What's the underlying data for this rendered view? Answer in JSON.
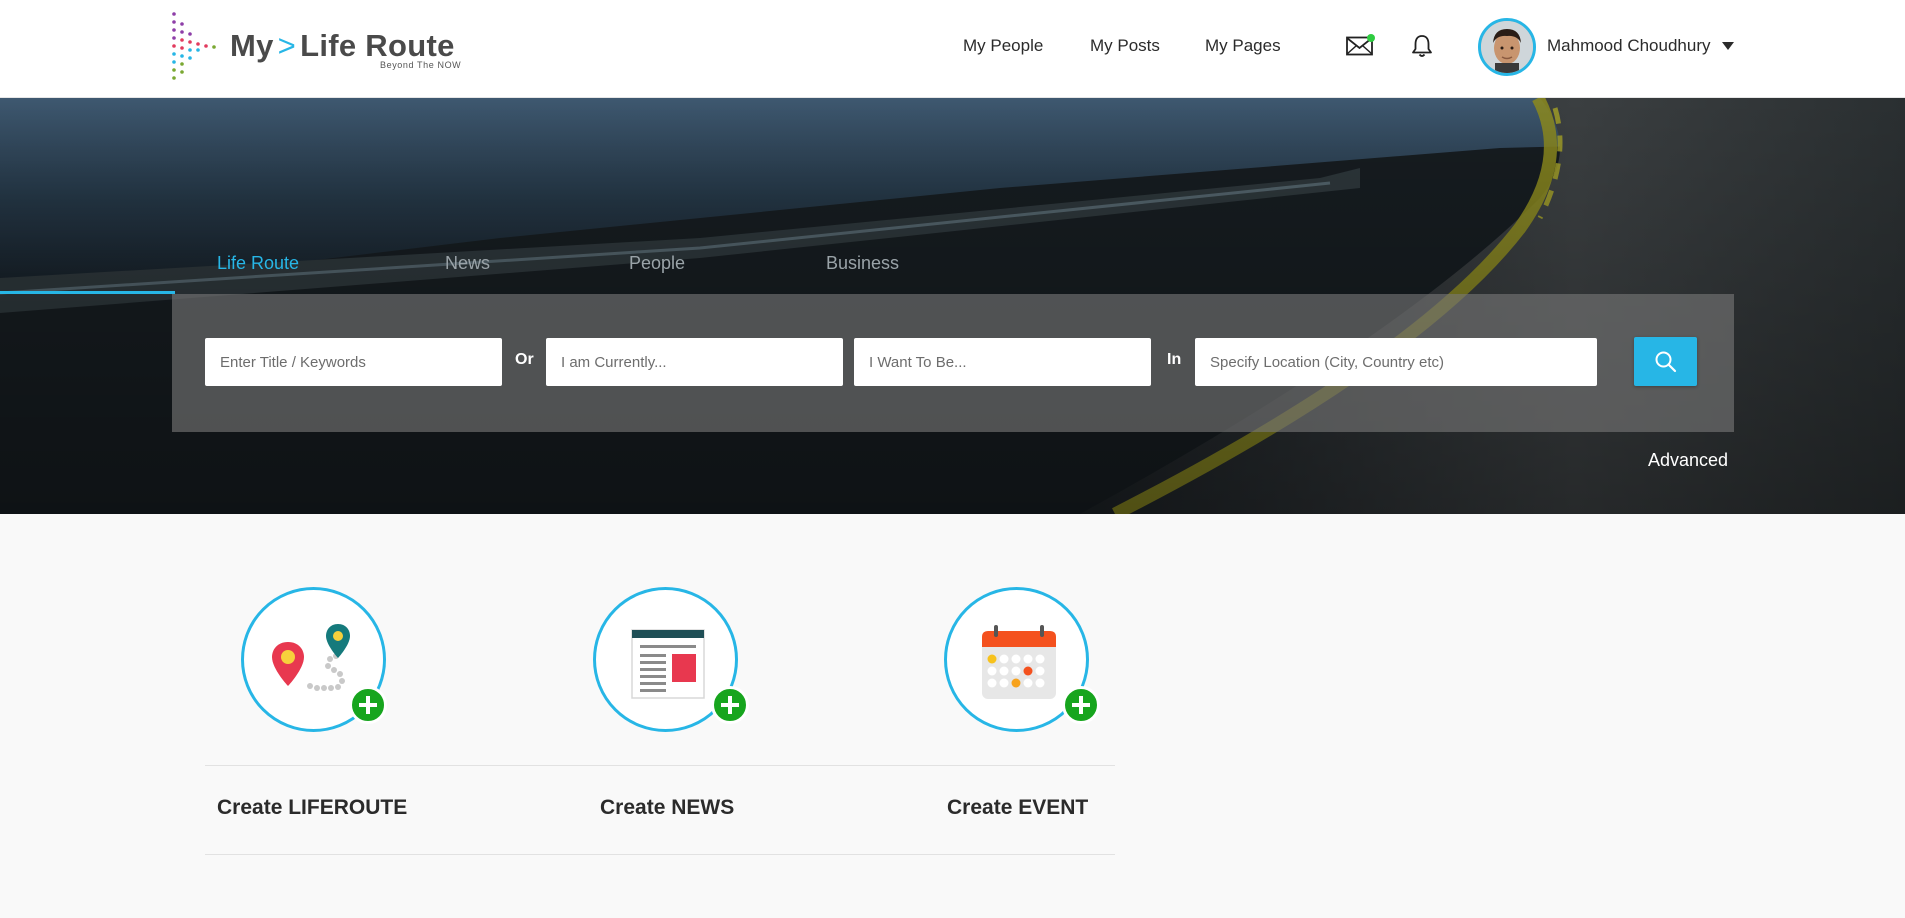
{
  "header": {
    "logo": {
      "main_left": "My",
      "chevron": ">",
      "main_right": "Life Route",
      "tagline": "Beyond The NOW"
    },
    "nav": [
      {
        "label": "My People"
      },
      {
        "label": "My Posts"
      },
      {
        "label": "My Pages"
      }
    ],
    "user": {
      "name": "Mahmood Choudhury"
    },
    "icons": [
      "mail-icon",
      "bell-icon",
      "chevron-down-icon",
      "search-icon"
    ]
  },
  "search": {
    "tabs": [
      {
        "label": "Life Route",
        "active": true
      },
      {
        "label": "News",
        "active": false
      },
      {
        "label": "People",
        "active": false
      },
      {
        "label": "Business",
        "active": false
      }
    ],
    "fields": {
      "keywords_placeholder": "Enter Title / Keywords",
      "current_placeholder": "I am Currently...",
      "want_placeholder": "I Want To Be...",
      "location_placeholder": "Specify Location (City, Country etc)"
    },
    "joiner_or": "Or",
    "joiner_in": "In",
    "advanced_label": "Advanced"
  },
  "create": [
    {
      "label": "Create LIFEROUTE",
      "icon": "map-pins-icon"
    },
    {
      "label": "Create NEWS",
      "icon": "newspaper-icon"
    },
    {
      "label": "Create EVENT",
      "icon": "calendar-icon"
    }
  ],
  "colors": {
    "accent": "#27b6e6",
    "plus": "#17a51e",
    "header_bg": "#ffffff",
    "body_bg": "#f9f9f9"
  }
}
